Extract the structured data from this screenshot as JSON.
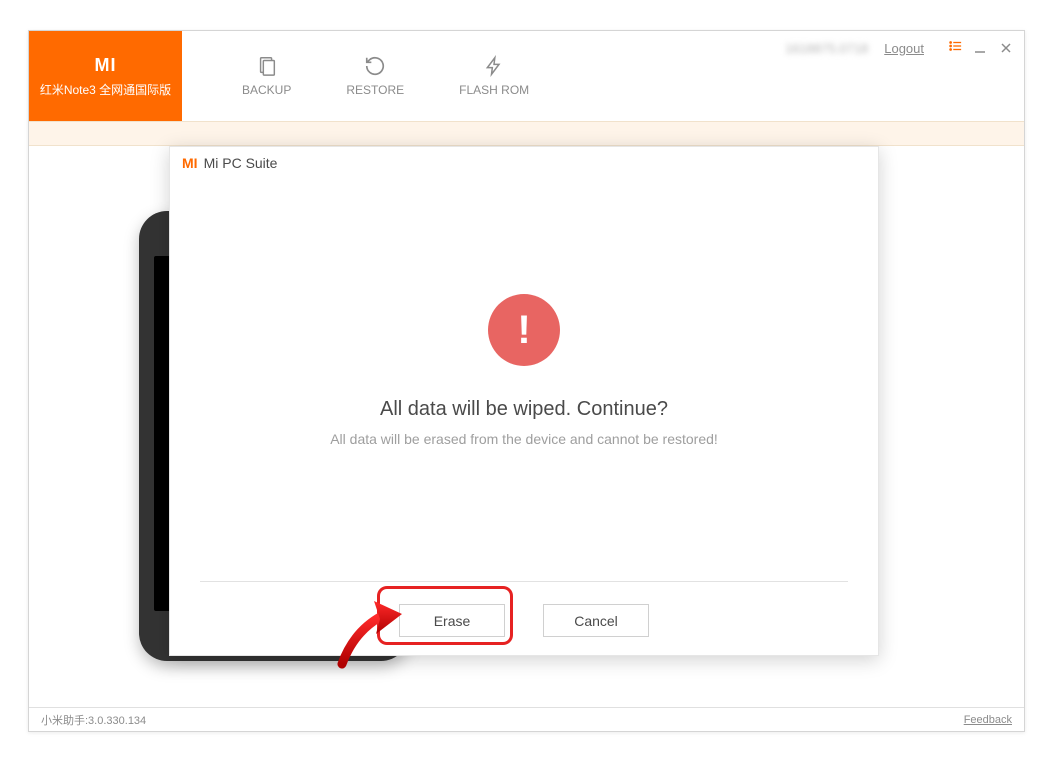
{
  "device": {
    "name": "红米Note3 全网通国际版"
  },
  "tabs": {
    "backup": "BACKUP",
    "restore": "RESTORE",
    "flashrom": "FLASH ROM"
  },
  "titlebar": {
    "user_id": "1618875.0718",
    "logout": "Logout"
  },
  "dialog": {
    "title": "Mi PC Suite",
    "heading": "All data will be wiped. Continue?",
    "subtext": "All data will be erased from the device and cannot be restored!",
    "erase": "Erase",
    "cancel": "Cancel"
  },
  "statusbar": {
    "version": "小米助手:3.0.330.134",
    "feedback": "Feedback"
  }
}
